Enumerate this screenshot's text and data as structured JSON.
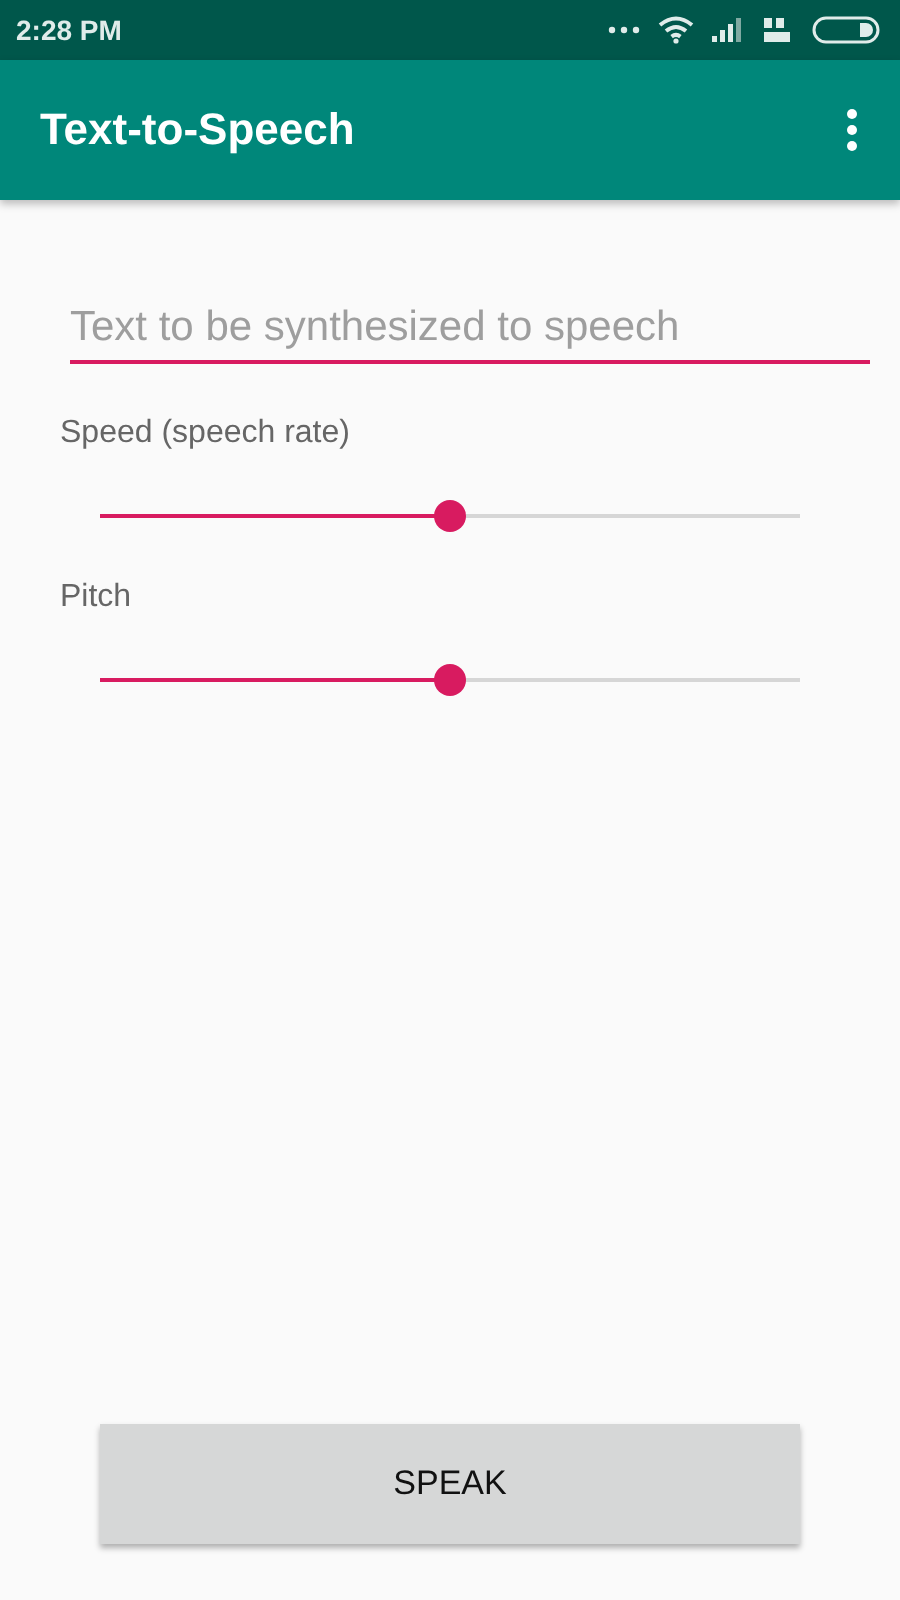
{
  "status_bar": {
    "time": "2:28 PM"
  },
  "app_bar": {
    "title": "Text-to-Speech"
  },
  "text_field": {
    "placeholder": "Text to be synthesized to speech"
  },
  "sliders": [
    {
      "label": "Speed (speech rate)",
      "level": 0.5
    },
    {
      "label": "Pitch",
      "level": 0.5
    }
  ],
  "button": {
    "label": "SPEAK"
  }
}
